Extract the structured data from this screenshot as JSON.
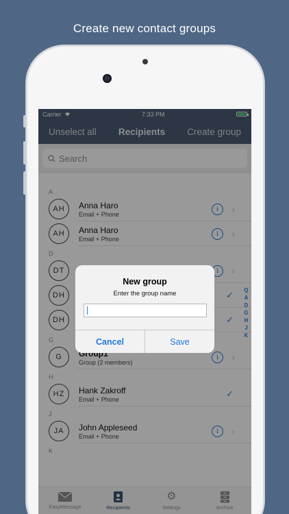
{
  "promo": {
    "caption": "Create new contact groups"
  },
  "status_bar": {
    "carrier": "Carrier",
    "time": "7:33 PM"
  },
  "navbar": {
    "left": "Unselect all",
    "title": "Recipients",
    "right": "Create group"
  },
  "search": {
    "placeholder": "Search"
  },
  "sections": [
    {
      "letter": "A",
      "rows": [
        {
          "initials": "AH",
          "name": "Anna Haro",
          "sub": "Email + Phone",
          "accessory": "info"
        },
        {
          "initials": "AH",
          "name": "Anna Haro",
          "sub": "Email + Phone",
          "accessory": "info"
        }
      ]
    },
    {
      "letter": "D",
      "rows": [
        {
          "initials": "DT",
          "name": "",
          "sub": "",
          "accessory": "info"
        },
        {
          "initials": "DH",
          "name": "",
          "sub": "",
          "accessory": "check"
        },
        {
          "initials": "DH",
          "name": "",
          "sub": "",
          "accessory": "check"
        }
      ]
    },
    {
      "letter": "G",
      "rows": [
        {
          "initials": "G",
          "name": "Group1",
          "sub": "Group (2 members)",
          "accessory": "info"
        }
      ]
    },
    {
      "letter": "H",
      "rows": [
        {
          "initials": "HZ",
          "name": "Hank Zakroff",
          "sub": "Email + Phone",
          "accessory": "check"
        }
      ]
    },
    {
      "letter": "J",
      "rows": [
        {
          "initials": "JA",
          "name": "John Appleseed",
          "sub": "Email + Phone",
          "accessory": "info"
        }
      ]
    },
    {
      "letter": "K",
      "rows": []
    }
  ],
  "index_letters": [
    "Q",
    "A",
    "D",
    "G",
    "H",
    "J",
    "K"
  ],
  "tabs": [
    {
      "label": "EasyMessage",
      "icon": "envelope-icon",
      "active": false
    },
    {
      "label": "Recipients",
      "icon": "contacts-icon",
      "active": true
    },
    {
      "label": "Settings",
      "icon": "gear-icon",
      "active": false
    },
    {
      "label": "Archive",
      "icon": "archive-icon",
      "active": false
    }
  ],
  "dialog": {
    "title": "New group",
    "message": "Enter the group name",
    "input_value": "",
    "cancel": "Cancel",
    "save": "Save"
  },
  "colors": {
    "background": "#4f6684",
    "navbar": "#4a5a72",
    "accent": "#2b7ed8"
  }
}
